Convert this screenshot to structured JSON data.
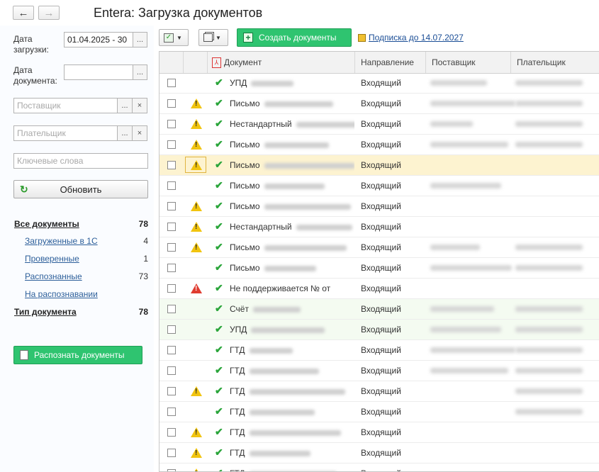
{
  "window": {
    "title": "Entera: Загрузка документов",
    "back_icon": "←",
    "forward_icon": "→"
  },
  "filters": {
    "load_date_label": "Дата загрузки:",
    "load_date_value": "01.04.2025 - 30",
    "doc_date_label": "Дата документа:",
    "doc_date_value": "",
    "supplier_placeholder": "Поставщик",
    "payer_placeholder": "Плательщик",
    "keywords_placeholder": "Ключевые слова",
    "dots_label": "...",
    "clear_label": "×",
    "refresh_label": "Обновить"
  },
  "nav": {
    "items": [
      {
        "label": "Все документы",
        "count": "78"
      },
      {
        "label": "Загруженные в 1С",
        "count": "4"
      },
      {
        "label": "Проверенные",
        "count": "1"
      },
      {
        "label": "Распознанные",
        "count": "73"
      },
      {
        "label": "На распознавании",
        "count": ""
      },
      {
        "label": "Тип документа",
        "count": "78"
      }
    ],
    "recognize_label": "Распознать документы"
  },
  "toolbar": {
    "create_label": "Создать документы",
    "subscription_label": "Подписка до 14.07.2027"
  },
  "table": {
    "headers": {
      "document": "Документ",
      "direction": "Направление",
      "supplier": "Поставщик",
      "payer": "Плательщик"
    },
    "rows": [
      {
        "doc": "УПД",
        "dir": "Входящий",
        "status": "none"
      },
      {
        "doc": "Письмо",
        "dir": "Входящий",
        "status": "warn"
      },
      {
        "doc": "Нестандартный",
        "dir": "Входящий",
        "status": "warn"
      },
      {
        "doc": "Письмо",
        "dir": "Входящий",
        "status": "warn"
      },
      {
        "doc": "Письмо",
        "dir": "Входящий",
        "status": "warn"
      },
      {
        "doc": "Письмо",
        "dir": "Входящий",
        "status": "none"
      },
      {
        "doc": "Письмо",
        "dir": "Входящий",
        "status": "warn"
      },
      {
        "doc": "Нестандартный",
        "dir": "Входящий",
        "status": "warn"
      },
      {
        "doc": "Письмо",
        "dir": "Входящий",
        "status": "warn"
      },
      {
        "doc": "Письмо",
        "dir": "Входящий",
        "status": "none"
      },
      {
        "doc": "Не поддерживается № от",
        "dir": "Входящий",
        "status": "error"
      },
      {
        "doc": "Счёт",
        "dir": "Входящий",
        "status": "none"
      },
      {
        "doc": "УПД",
        "dir": "Входящий",
        "status": "none"
      },
      {
        "doc": "ГТД",
        "dir": "Входящий",
        "status": "none"
      },
      {
        "doc": "ГТД",
        "dir": "Входящий",
        "status": "none"
      },
      {
        "doc": "ГТД",
        "dir": "Входящий",
        "status": "warn"
      },
      {
        "doc": "ГТД",
        "dir": "Входящий",
        "status": "none"
      },
      {
        "doc": "ГТД",
        "dir": "Входящий",
        "status": "warn"
      },
      {
        "doc": "ГТД",
        "dir": "Входящий",
        "status": "warn"
      },
      {
        "doc": "ГТД",
        "dir": "Входящий",
        "status": "warn"
      }
    ]
  },
  "colors": {
    "accent_green": "#2fc470",
    "selected_row": "#fdf3d0",
    "loaded_row": "#f4fbf1"
  }
}
